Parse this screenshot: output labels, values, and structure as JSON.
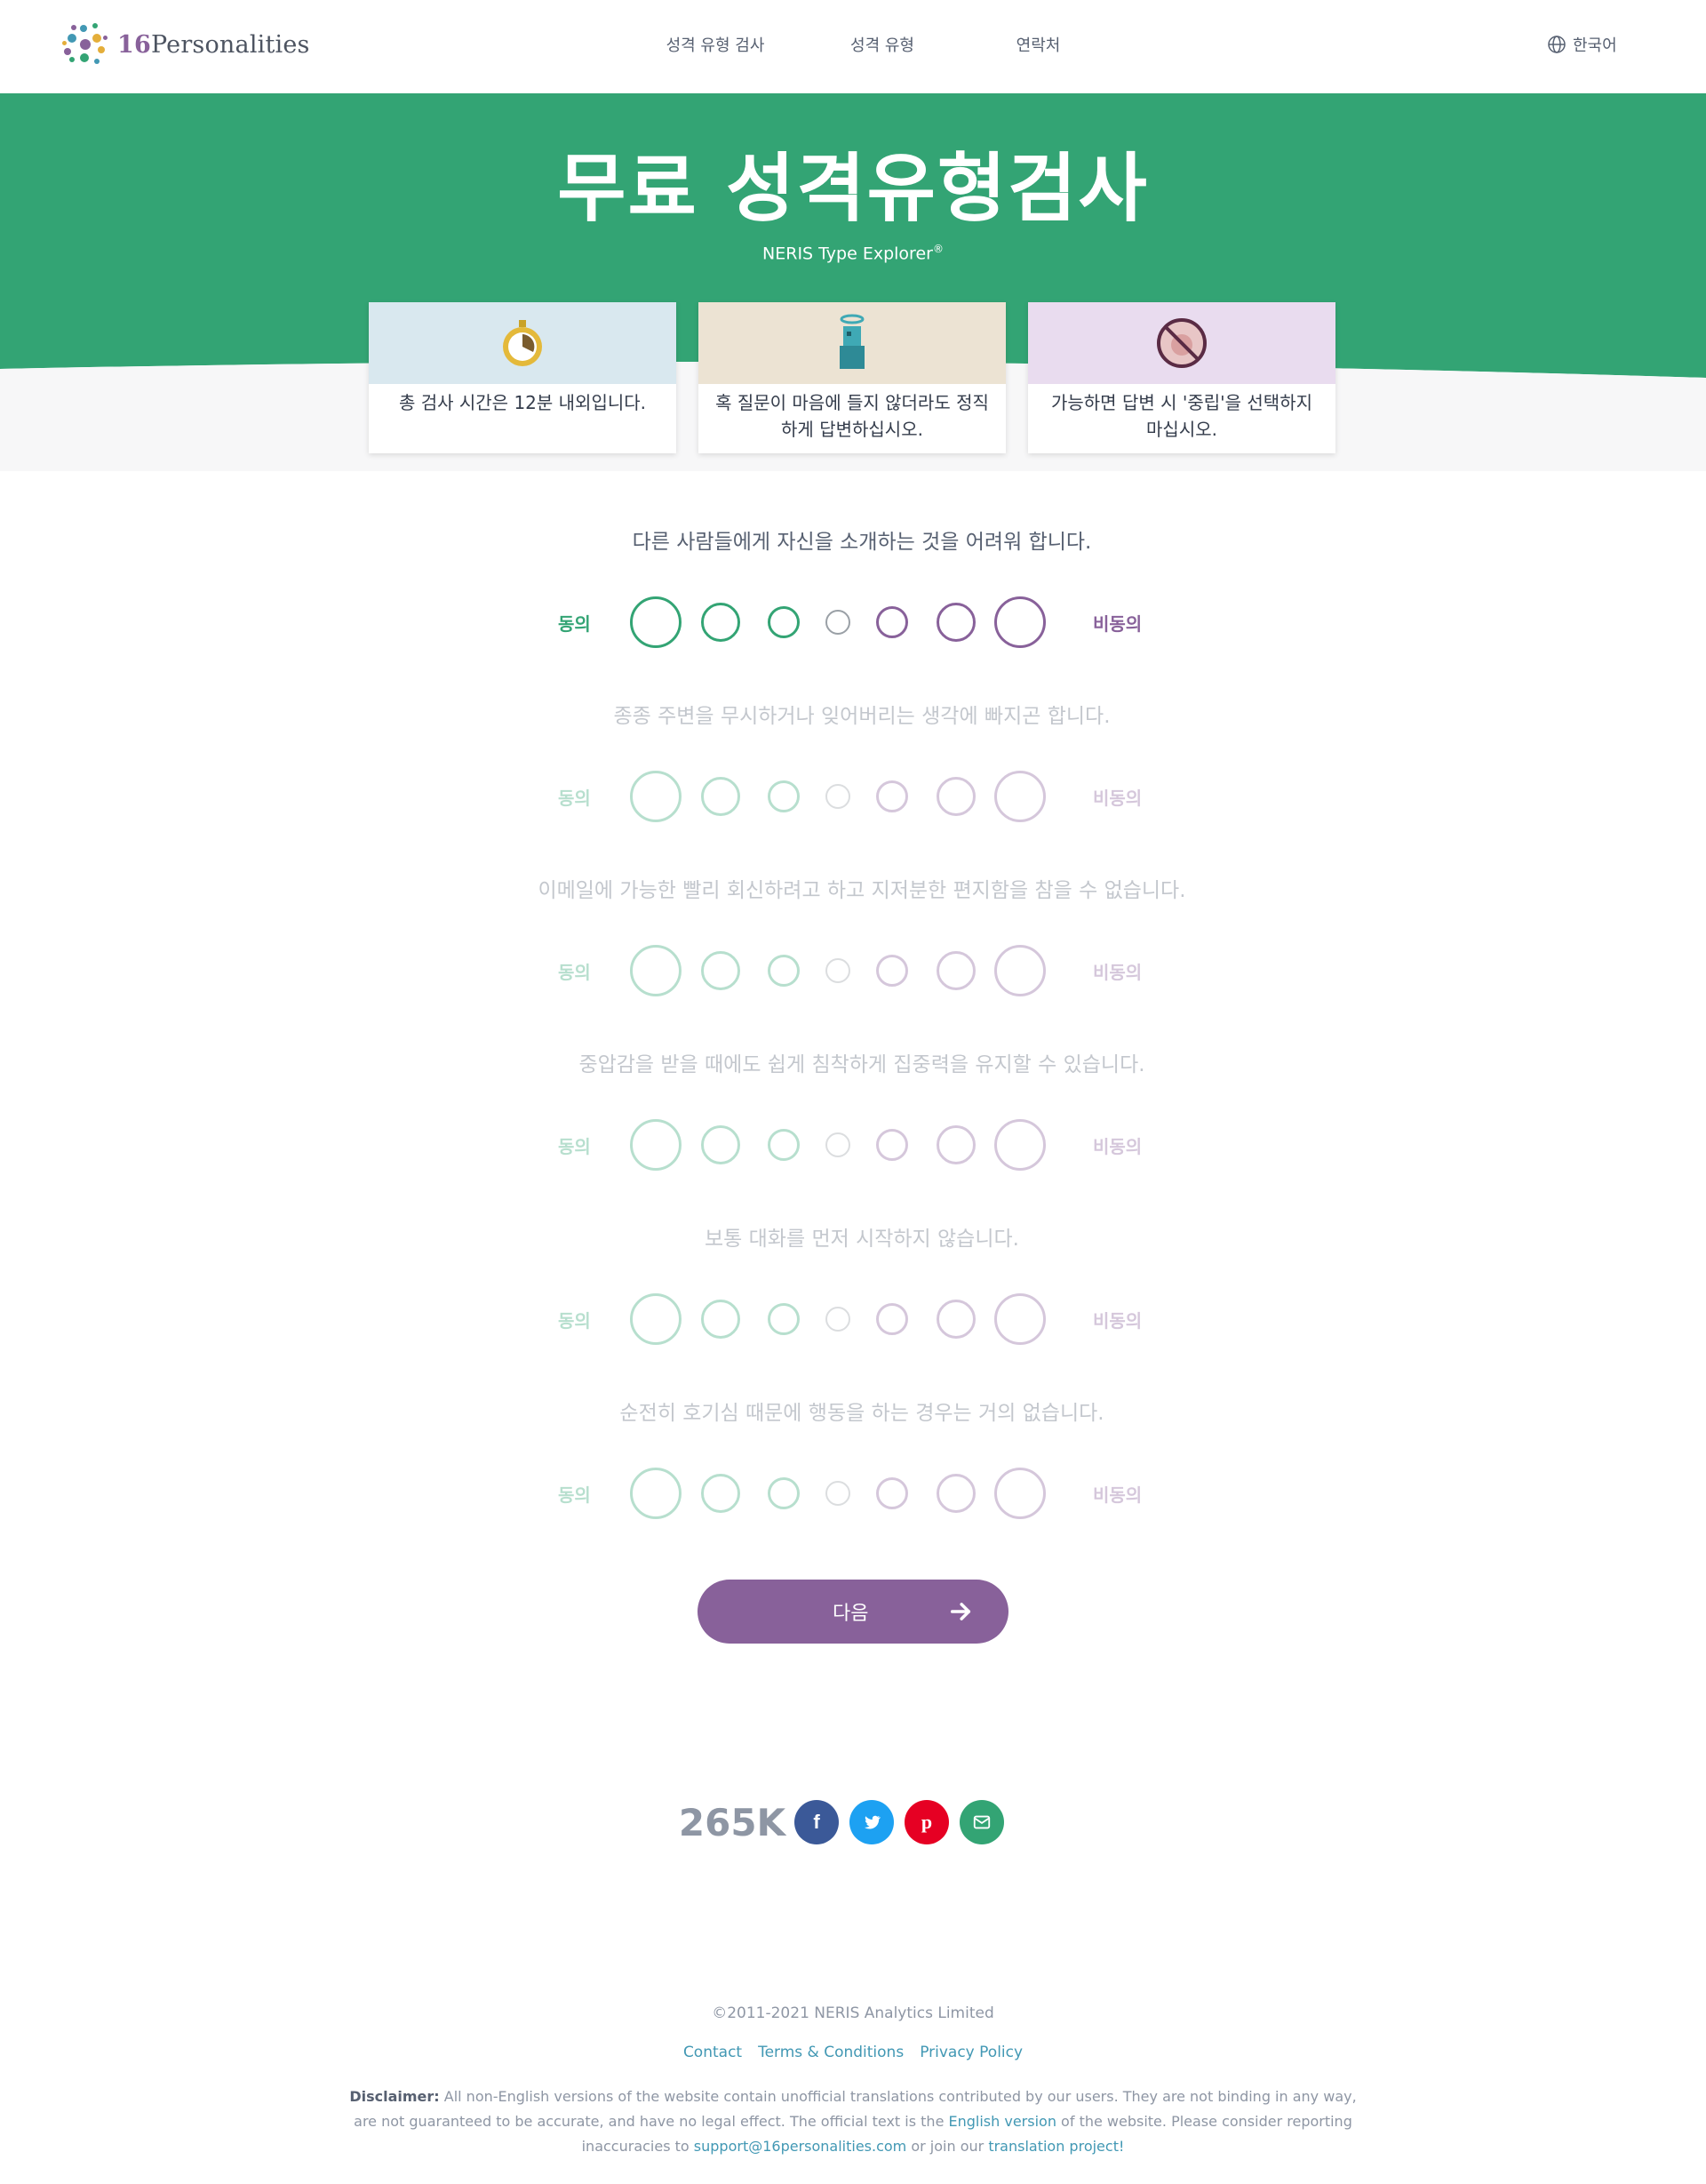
{
  "header": {
    "logo_num": "16",
    "logo_word": "Personalities",
    "nav": [
      "성격 유형 검사",
      "성격 유형",
      "연락처"
    ],
    "language": "한국어"
  },
  "hero": {
    "title": "무료 성격유형검사",
    "subtitle": "NERIS Type Explorer",
    "subtitle_mark": "®",
    "cards": [
      "총 검사 시간은 12분 내외입니다.",
      "혹 질문이 마음에 들지 않더라도 정직하게 답변하십시오.",
      "가능하면 답변 시 '중립'을 선택하지 마십시오."
    ]
  },
  "questions": [
    {
      "text": "다른 사람들에게 자신을 소개하는 것을 어려워 합니다.",
      "active": true
    },
    {
      "text": "종종 주변을 무시하거나 잊어버리는 생각에 빠지곤 합니다.",
      "active": false
    },
    {
      "text": "이메일에 가능한 빨리 회신하려고 하고 지저분한 편지함을 참을 수 없습니다.",
      "active": false
    },
    {
      "text": "중압감을 받을 때에도 쉽게 침착하게 집중력을 유지할 수 있습니다.",
      "active": false
    },
    {
      "text": "보통 대화를 먼저 시작하지 않습니다.",
      "active": false
    },
    {
      "text": "순전히 호기심 때문에 행동을 하는 경우는 거의 없습니다.",
      "active": false
    }
  ],
  "scale": {
    "agree": "동의",
    "disagree": "비동의"
  },
  "colors": {
    "green": "#33a474",
    "purple": "#88619a",
    "neutral": "#9aa0a6",
    "facebook": "#3b5998",
    "twitter": "#1da1f2",
    "pinterest": "#e60023",
    "email": "#33a474"
  },
  "next": {
    "label": "다음"
  },
  "share": {
    "count": "265K",
    "buttons": [
      "facebook-icon",
      "twitter-icon",
      "pinterest-icon",
      "email-icon"
    ]
  },
  "footer": {
    "copyright": "©2011-2021 NERIS Analytics Limited",
    "links": [
      "Contact",
      "Terms & Conditions",
      "Privacy Policy"
    ],
    "disclaimer_label": "Disclaimer:",
    "disclaimer_part1": " All non-English versions of the website contain unofficial translations contributed by our users. They are not binding in any way, are not guaranteed to be accurate, and have no legal effect. The official text is the ",
    "english_link": "English version",
    "disclaimer_part2": " of the website. Please consider reporting inaccuracies to ",
    "support_link": "support@16personalities.com",
    "disclaimer_part3": " or join our ",
    "translation_link": "translation project!"
  }
}
